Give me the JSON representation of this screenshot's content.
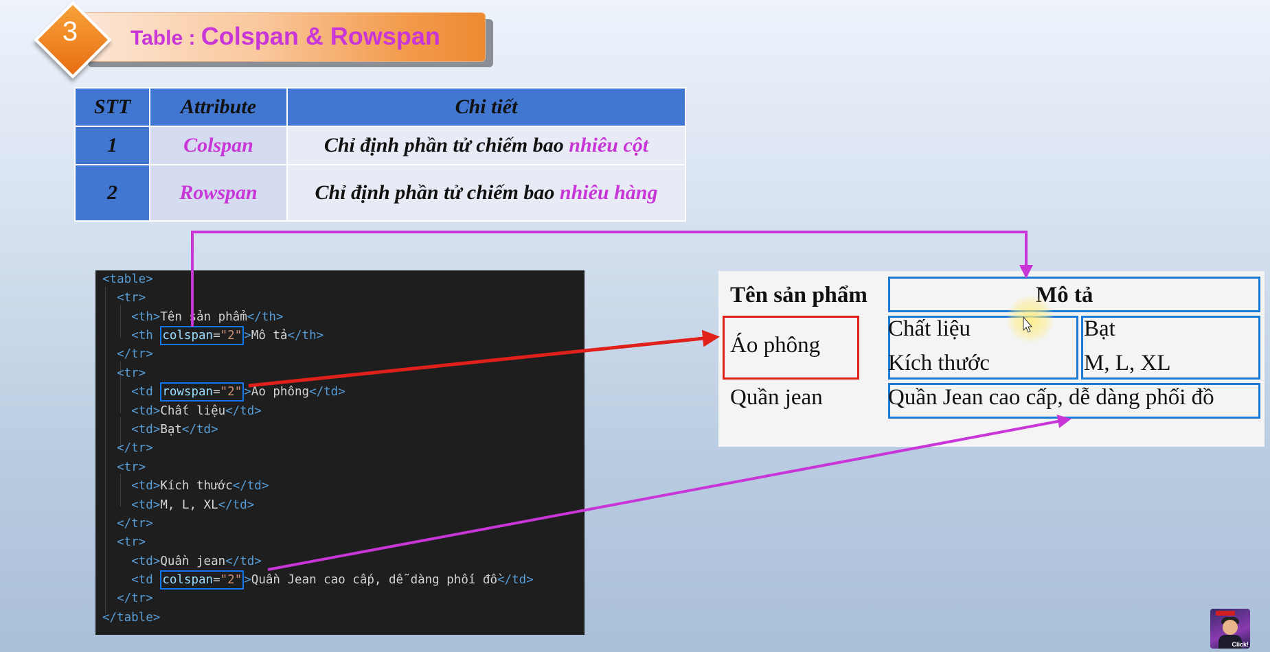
{
  "header": {
    "badge_number": "3",
    "title_prefix": "Table : ",
    "title_main": "Colspan & Rowspan"
  },
  "attr_table": {
    "headers": [
      "STT",
      "Attribute",
      "Chi tiết"
    ],
    "rows": [
      {
        "num": "1",
        "attribute": "Colspan",
        "desc_plain": "Chỉ định phần tử chiếm bao ",
        "desc_highlight": "nhiêu cột"
      },
      {
        "num": "2",
        "attribute": "Rowspan",
        "desc_plain": "Chỉ định phần tử chiếm bao ",
        "desc_highlight": "nhiêu hàng"
      }
    ]
  },
  "code": {
    "l1": "<table>",
    "l2": "<tr>",
    "l3_open": "<th>",
    "l3_text": "Tên sản phẩm",
    "l3_close": "</th>",
    "l4_open": "<th ",
    "l4_attr": "colspan",
    "l4_eq": "=",
    "l4_val": "\"2\"",
    "l4_gt": ">",
    "l4_text": "Mô tả",
    "l4_close": "</th>",
    "l5": "</tr>",
    "l6": "<tr>",
    "l7_open": "<td ",
    "l7_attr": "rowspan",
    "l7_eq": "=",
    "l7_val": "\"2\"",
    "l7_gt": ">",
    "l7_text": "Áo phông",
    "l7_close": "</td>",
    "l8_open": "<td>",
    "l8_text": "Chất liệu",
    "l8_close": "</td>",
    "l9_open": "<td>",
    "l9_text": "Bạt",
    "l9_close": "</td>",
    "l10": "</tr>",
    "l11": "<tr>",
    "l12_open": "<td>",
    "l12_text": "Kích thước",
    "l12_close": "</td>",
    "l13_open": "<td>",
    "l13_text": "M, L, XL",
    "l13_close": "</td>",
    "l14": "</tr>",
    "l15": "<tr>",
    "l16_open": "<td>",
    "l16_text": "Quần jean",
    "l16_close": "</td>",
    "l17_open": "<td ",
    "l17_attr": "colspan",
    "l17_eq": "=",
    "l17_val": "\"2\"",
    "l17_gt": ">",
    "l17_text": "Quần Jean cao cấp, dễ dàng phối đồ",
    "l17_close": "</td>",
    "l18": "</tr>",
    "l19": "</table>"
  },
  "output": {
    "th_name": "Tên sản phẩm",
    "th_desc": "Mô tả",
    "ao_phong": "Áo phông",
    "chat_lieu": "Chất liệu",
    "bat": "Bạt",
    "kich_thuoc": "Kích thước",
    "sizes": "M, L, XL",
    "quan_jean": "Quần jean",
    "quan_desc": "Quần Jean cao cấp, dễ dàng phối đồ"
  },
  "avatar": {
    "caption": "Click!"
  },
  "colors": {
    "pink": "#c836d8",
    "red": "#e0201a",
    "blue": "#1b7ad6",
    "header_blue": "#4177d1",
    "orange": "#ee8a32"
  }
}
